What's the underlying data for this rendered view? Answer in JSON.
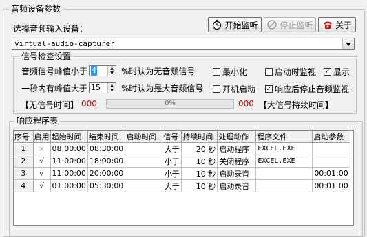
{
  "main_group": {
    "title": "音频设备参数"
  },
  "buttons": {
    "start": "开始监听",
    "stop": "停止监听",
    "about": "关于"
  },
  "device": {
    "label": "选择音频输入设备：",
    "selected": "virtual-audio-capturer"
  },
  "signal": {
    "group_title": "信号检查设置",
    "peak_label": "音频信号峰值小于",
    "peak_value": "4",
    "peak_suffix": "%时认为无音频信号",
    "sec_label": "一秒内有峰值大于",
    "sec_value": "15",
    "sec_suffix": "%时认为是大音频信号",
    "no_signal_label": "【无信号时间】",
    "no_signal_value": "000",
    "progress_text": "0%",
    "progress_fraction": 0,
    "big_signal_value": "000",
    "big_signal_label": "【大信号持续时间】",
    "checkboxes": [
      {
        "label": "最小化",
        "checked": false
      },
      {
        "label": "启动时监视",
        "checked": false
      },
      {
        "label": "显示",
        "checked": true
      },
      {
        "label": "开机启动",
        "checked": false
      },
      {
        "label": "响应后停止音频监视",
        "checked": true
      }
    ]
  },
  "response": {
    "group_title": "响应程序表",
    "columns": [
      "序号",
      "启用",
      "起始时间",
      "结束时间",
      "启动时间",
      "信号",
      "持续时间",
      "处理动作",
      "程序文件",
      "启动参数"
    ],
    "rows": [
      {
        "no": "1",
        "enabled": "×",
        "start": "08:00:00",
        "end": "08:30:00",
        "launch": "",
        "signal": "大于",
        "duration": "20 秒",
        "action": "启动程序",
        "file": "EXCEL.EXE",
        "params": ""
      },
      {
        "no": "2",
        "enabled": "√",
        "start": "11:00:00",
        "end": "18:00:00",
        "launch": "",
        "signal": "小于",
        "duration": "10 秒",
        "action": "关闭程序",
        "file": "EXCEL.EXE",
        "params": ""
      },
      {
        "no": "3",
        "enabled": "√",
        "start": "11:00:00",
        "end": "20:00:00",
        "launch": "",
        "signal": "小于",
        "duration": "10 秒",
        "action": "启动录音",
        "file": "",
        "params": "00:01:00"
      },
      {
        "no": "4",
        "enabled": "√",
        "start": "01:00:00",
        "end": "05:30:00",
        "launch": "",
        "signal": "大于",
        "duration": "10 秒",
        "action": "启动录音",
        "file": "",
        "params": "00:01:00"
      }
    ]
  }
}
